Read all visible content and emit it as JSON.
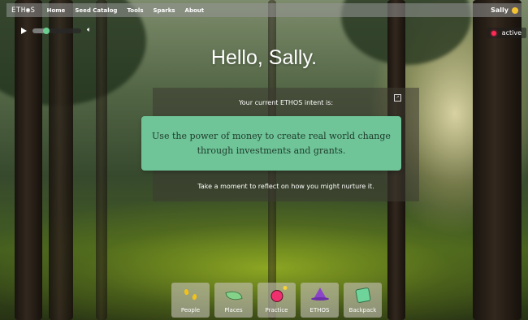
{
  "nav": {
    "brand": "ETH◉S",
    "links": [
      "Home",
      "Seed Catalog",
      "Tools",
      "Sparks",
      "About"
    ],
    "user_name": "Sally"
  },
  "player": {
    "progress": 0.28
  },
  "status": {
    "label": "active",
    "dot_color": "#ff2a55"
  },
  "greeting": "Hello, Sally.",
  "intent": {
    "label": "Your current ETHOS intent is:",
    "text": "Use the power of money to create real world change through investments and grants.",
    "reflect": "Take a moment to reflect on how you might nurture it."
  },
  "dock": {
    "items": [
      {
        "label": "People",
        "icon": "footprints-icon"
      },
      {
        "label": "Places",
        "icon": "leaf-icon"
      },
      {
        "label": "Practice",
        "icon": "bomb-icon"
      },
      {
        "label": "ETHOS",
        "icon": "wizard-hat-icon"
      },
      {
        "label": "Backpack",
        "icon": "backpack-icon"
      }
    ]
  },
  "colors": {
    "intent_card": "#6fc498",
    "accent_green": "#6bd08f"
  }
}
